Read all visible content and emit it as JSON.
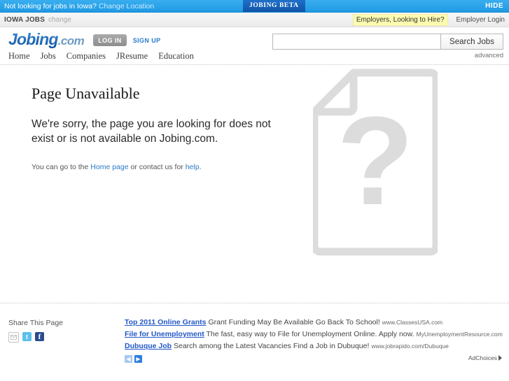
{
  "beta_bar": {
    "notice_text": "Not looking for jobs in Iowa?",
    "change_location_label": "Change Location",
    "beta_tab_label": "JOBING BETA",
    "hide_label": "HIDE"
  },
  "market_bar": {
    "market_name": "IOWA JOBS",
    "change_label": "change",
    "employers_hire_label": "Employers, Looking to Hire?",
    "employer_login_label": "Employer Login",
    "highlight_color": "#fdfbaf"
  },
  "header": {
    "logo_main": "Jobing",
    "logo_suffix": ".com",
    "login_label": "LOG IN",
    "signup_label": "SIGN UP",
    "nav": [
      {
        "label": "Home"
      },
      {
        "label": "Jobs"
      },
      {
        "label": "Companies"
      },
      {
        "label": "JResume"
      },
      {
        "label": "Education"
      }
    ],
    "search": {
      "value": "",
      "placeholder": "",
      "button_label": "Search Jobs",
      "advanced_label": "advanced"
    },
    "accent_color": "#2a7bc8"
  },
  "content": {
    "title": "Page Unavailable",
    "message": "We're sorry, the page you are looking for does not exist or is not available on Jobing.com.",
    "help_prefix": "You can go to the ",
    "help_home_link": "Home page",
    "help_middle": " or contact us for ",
    "help_link": "help",
    "help_suffix": ".",
    "graphic_name": "document-question-mark",
    "graphic_color": "#dcdcdc"
  },
  "footer": {
    "share_label": "Share This Page",
    "share_icons": [
      {
        "name": "email-share-icon",
        "glyph": "✉",
        "color": "#ffffff"
      },
      {
        "name": "twitter-share-icon",
        "glyph": "t",
        "color": "#5cc0ec"
      },
      {
        "name": "facebook-share-icon",
        "glyph": "f",
        "color": "#2b4b8f"
      }
    ],
    "ads": [
      {
        "title": "Top 2011 Online Grants",
        "description": "Grant Funding May Be Available Go Back To School!",
        "url": "www.ClassesUSA.com"
      },
      {
        "title": "File for Unemployment",
        "description": "The fast, easy way to File for Unemployment Online. Apply now.",
        "url": "MyUnemploymentResource.com"
      },
      {
        "title": "Dubuque Job",
        "description": "Search among the Latest Vacancies Find a Job in Dubuque!",
        "url": "www.jobrapido.com/Dubuque"
      }
    ],
    "pager": {
      "prev_glyph": "◀",
      "next_glyph": "▶"
    },
    "adchoices_label": "AdChoices"
  }
}
